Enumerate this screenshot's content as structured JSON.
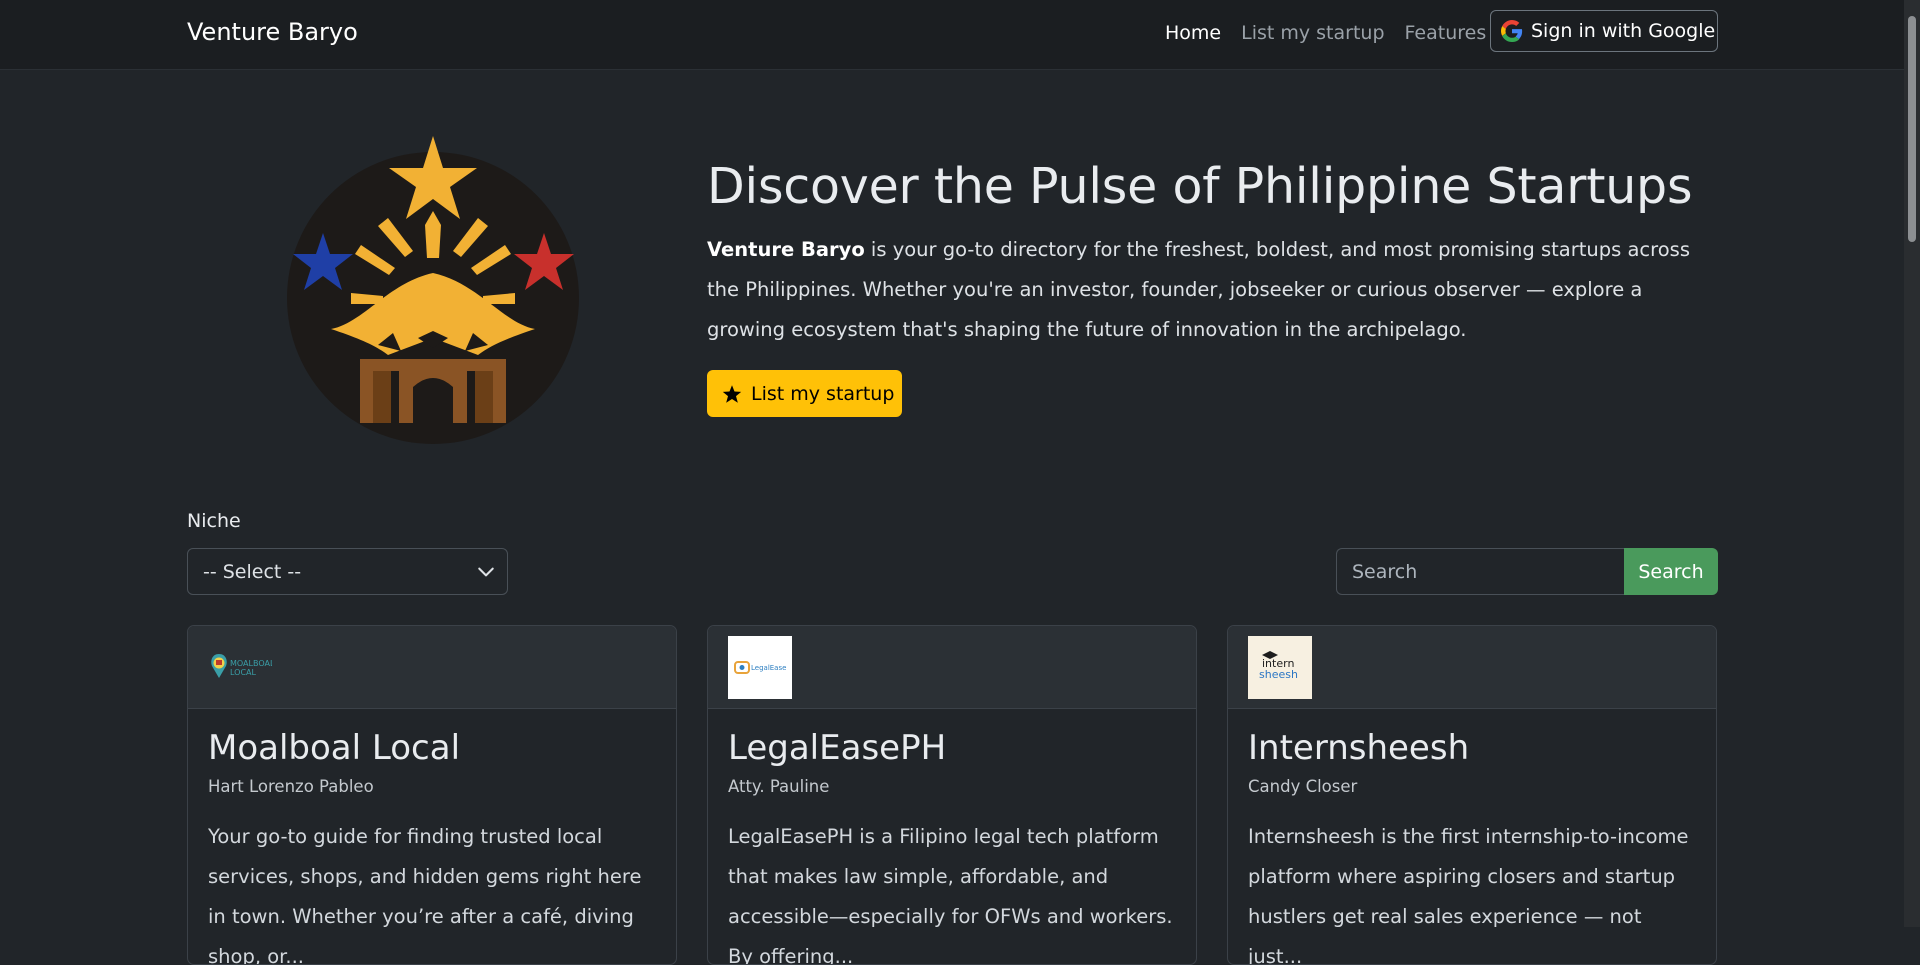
{
  "navbar": {
    "brand": "Venture Baryo",
    "links": [
      "Home",
      "List my startup",
      "Features"
    ],
    "google_button": "Sign in with Google"
  },
  "hero": {
    "title": "Discover the Pulse of Philippine Startups",
    "desc_bold": "Venture Baryo",
    "desc_rest": " is your go-to directory for the freshest, boldest, and most promising startups across the Philippines. Whether you're an investor, founder, jobseeker or curious observer — explore a growing ecosystem that's shaping the future of innovation in the archipelago.",
    "cta": "List my startup"
  },
  "filters": {
    "niche_label": "Niche",
    "niche_selected": "-- Select --",
    "search_placeholder": "Search",
    "search_button": "Search"
  },
  "cards": [
    {
      "logo_text": [
        "MOALBOAL",
        "LOCAL"
      ],
      "title": "Moalboal Local",
      "owner": "Hart Lorenzo Pableo",
      "text": "Your go-to guide for finding trusted local services, shops, and hidden gems right here in town. Whether you’re after a café, diving shop, or..."
    },
    {
      "logo_text": [
        "LegalEase"
      ],
      "title": "LegalEasePH",
      "owner": "Atty. Pauline",
      "text": "LegalEasePH is a Filipino legal tech platform that makes law simple, affordable, and accessible—especially for OFWs and workers. By offering..."
    },
    {
      "logo_text": [
        "intern",
        "sheesh"
      ],
      "title": "Internsheesh",
      "owner": "Candy Closer",
      "text": "Internsheesh is the first internship-to-income platform where aspiring closers and startup hustlers get real sales experience — not just..."
    }
  ],
  "colors": {
    "background": "#212529",
    "navbar": "#1b1e21",
    "accent_yellow": "#ffc107",
    "search_green": "#4a9a5c",
    "logo_gold": "#f2b134",
    "logo_blue": "#1f3fa6",
    "logo_red": "#c8302c",
    "logo_brown": "#8a5425"
  }
}
